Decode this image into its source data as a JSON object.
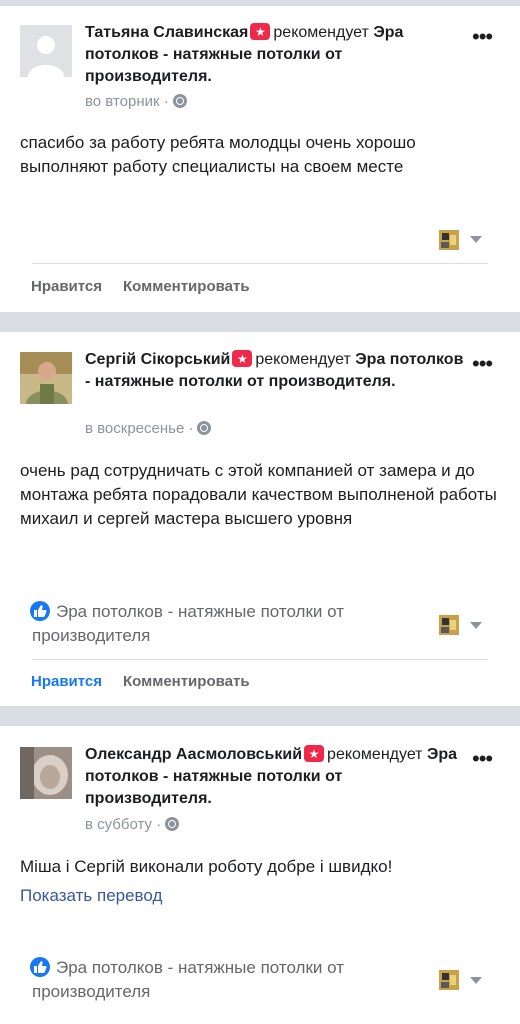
{
  "colors": {
    "separator": "#dadde1",
    "link": "#385898",
    "like_active": "#1877f2",
    "badge": "#f02849",
    "meta": "#8d949e"
  },
  "posts": [
    {
      "author": "Татьяна Славинская",
      "verb": "рекомендует",
      "page": "Эра потолков - натяжные потолки от производителя.",
      "time": "во вторник",
      "dot": "·",
      "text": "спасибо за работу ребята молодцы очень хорошо выполняют работу специалисты на своем месте",
      "actions": {
        "like": "Нравится",
        "comment": "Комментировать"
      },
      "liked": false
    },
    {
      "author": "Сергій Сікорський",
      "verb": "рекомендует",
      "page": "Эра потолков - натяжные потолки от производителя.",
      "time": "в воскресенье",
      "dot": "·",
      "text": "очень рад сотрудничать с этой компанией от замера и до монтажа ребята порадовали качеством выполненой работы михаил и сергей мастера высшего уровня",
      "liked_by": "Эра потолков - натяжные потолки от производителя",
      "actions": {
        "like": "Нравится",
        "comment": "Комментировать"
      },
      "liked": true
    },
    {
      "author": "Олександр Аасмоловський",
      "verb": "рекомендует",
      "page": "Эра потолков - натяжные потолки от производителя.",
      "time": "в субботу",
      "dot": "·",
      "text": "Міша і Сергій виконали роботу добре і швидко!",
      "translate": "Показать перевод",
      "liked_by": "Эра потолков - натяжные потолки от производителя"
    }
  ],
  "icons": {
    "more": "more-options-icon",
    "globe": "globe-icon",
    "recommend": "recommend-badge-icon",
    "like": "like-thumb-icon",
    "reaction": "page-reaction-icon",
    "caret": "caret-down-icon"
  }
}
